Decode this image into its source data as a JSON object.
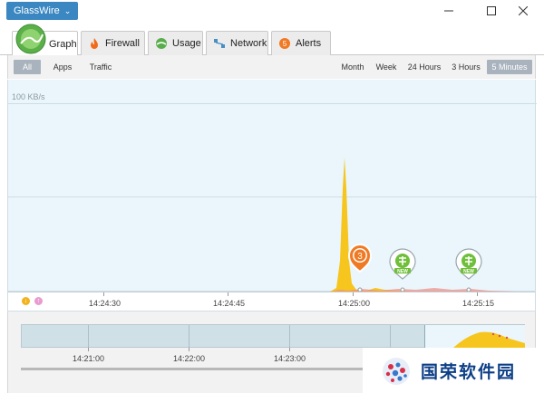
{
  "app": {
    "menu_label": "GlassWire"
  },
  "window_controls": {
    "minimize": "—",
    "maximize": "☐",
    "close": "✕"
  },
  "tabs": [
    {
      "label": "Graph",
      "icon": "graph-icon",
      "active": true
    },
    {
      "label": "Firewall",
      "icon": "flame-icon",
      "active": false
    },
    {
      "label": "Usage",
      "icon": "usage-icon",
      "active": false
    },
    {
      "label": "Network",
      "icon": "network-icon",
      "active": false
    },
    {
      "label": "Alerts",
      "icon": "alert-badge-icon",
      "badge": "5",
      "active": false
    }
  ],
  "filters": {
    "view": [
      "All",
      "Apps",
      "Traffic"
    ],
    "view_selected": "All",
    "ranges": [
      "Month",
      "Week",
      "24 Hours",
      "3 Hours",
      "5 Minutes"
    ],
    "range_selected": "5 Minutes"
  },
  "graph": {
    "scale_label": "100 KB/s",
    "x_ticks": [
      "14:24:30",
      "14:24:45",
      "14:25:00",
      "14:25:15"
    ],
    "markers": [
      {
        "type": "alert",
        "label": "3",
        "color": "#f07a24"
      },
      {
        "type": "new",
        "label": "NEW",
        "color": "#6fbf3a"
      },
      {
        "type": "new",
        "label": "NEW",
        "color": "#6fbf3a"
      }
    ],
    "legend": {
      "download": "↓",
      "upload": "↑"
    }
  },
  "overview": {
    "x_ticks": [
      "14:21:00",
      "14:22:00",
      "14:23:00"
    ]
  },
  "watermark": {
    "text": "国荣软件园"
  },
  "colors": {
    "accent": "#3b87c2",
    "download": "#f6c51e",
    "upload": "#f08a82",
    "graph_bg": "#eaf6fb"
  }
}
